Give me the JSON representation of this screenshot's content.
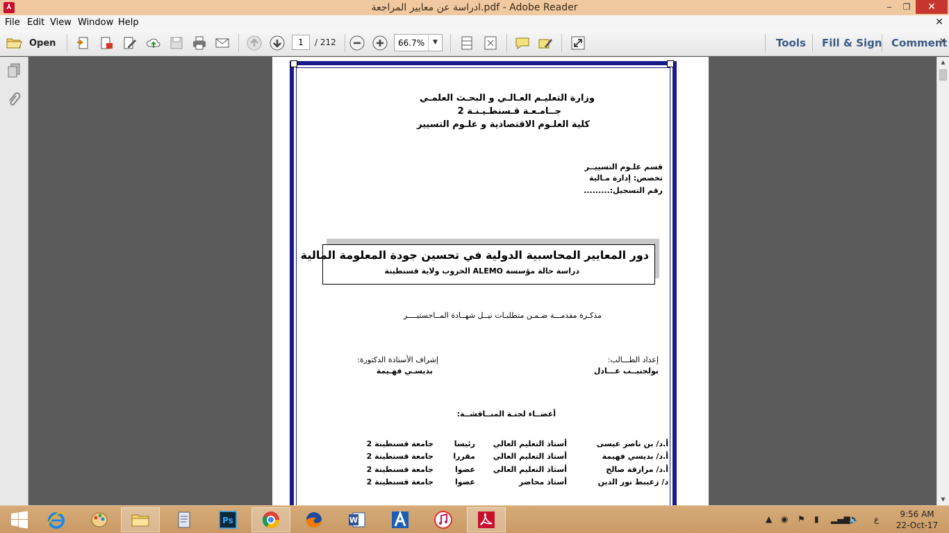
{
  "window": {
    "title": "ادراسة عن معايير المراجعة.pdf - Adobe Reader",
    "minimize": "‒",
    "maximize": "❐",
    "close": "✕"
  },
  "menu": {
    "items": [
      "File",
      "Edit",
      "View",
      "Window",
      "Help"
    ],
    "close_glyph": "✕"
  },
  "toolbar": {
    "open_label": "Open",
    "page_current": "1",
    "page_total": "/ 212",
    "zoom": "66.7%",
    "tools_label": "Tools",
    "fill_sign_label": "Fill & Sign",
    "comment_label": "Comment",
    "close_glyph": "✕"
  },
  "document": {
    "ministry": "وزارة التعليـم العـالـي و البحـث العلمـي",
    "university": "جــامـعـة قـسنطـيـنـة 2",
    "faculty": "كلية العلـوم الاقتصادية و علـوم التسيير",
    "department": "قسم علـوم التسييــر",
    "specialty": "تخصص: إدارة مـالية",
    "registration": "رقم التسجيل:.........",
    "thesis_title": "دور المعايير المحاسبية الدولية في تحسين جودة المعلومة المالية",
    "case_study": "دراسة حالة مؤسسة ALEMO الخروب ولاية قسنطينة",
    "memo": "مذكـرة مقدمـــة ضـمـن متطلبـات نيــل شهــادة المــاجستيــــر",
    "prepared_label": "إعداد الطـــالب:",
    "student_name": "بولجنيــب عـــادل",
    "supervisor_label": "إشراف الأستاذة الدكتورة:",
    "supervisor_name": "بديسـي فهـيمة",
    "committee_title": "أعضــاء لجنـة المنــاقشــة:",
    "committee": [
      {
        "name": "أ.د/ بن ناصر عيسى",
        "rank": "أستاذ التعليم العالي",
        "role": "رئيسا",
        "university": "جامعة قسنطينة 2"
      },
      {
        "name": "أ.د/ بديسي فهيمة",
        "rank": "أستاذ التعليم العالي",
        "role": "مقررا",
        "university": "جامعة قسنطينة 2"
      },
      {
        "name": "أ.د/ مرازقة صالح",
        "rank": "أستاذ التعليم العالي",
        "role": "عضوا",
        "university": "جامعة قسنطينة 2"
      },
      {
        "name": "د/ زعيبط نور الدين",
        "rank": "أستاذ محاضر",
        "role": "عضوا",
        "university": "جامعة قسنطينة 2"
      }
    ]
  },
  "taskbar": {
    "apps": [
      "start",
      "internet-explorer",
      "paint",
      "file-explorer",
      "notepad",
      "photoshop",
      "chrome",
      "firefox",
      "word",
      "app-a",
      "itunes",
      "adobe-reader"
    ],
    "lang": "ع",
    "time": "9:56 AM",
    "date": "22-Oct-17"
  },
  "colors": {
    "title_bar": "#f0c9a0",
    "taskbar": "#d0a370",
    "frame": "#1a1a8c",
    "link": "#3b5b86",
    "close": "#c7372f"
  }
}
